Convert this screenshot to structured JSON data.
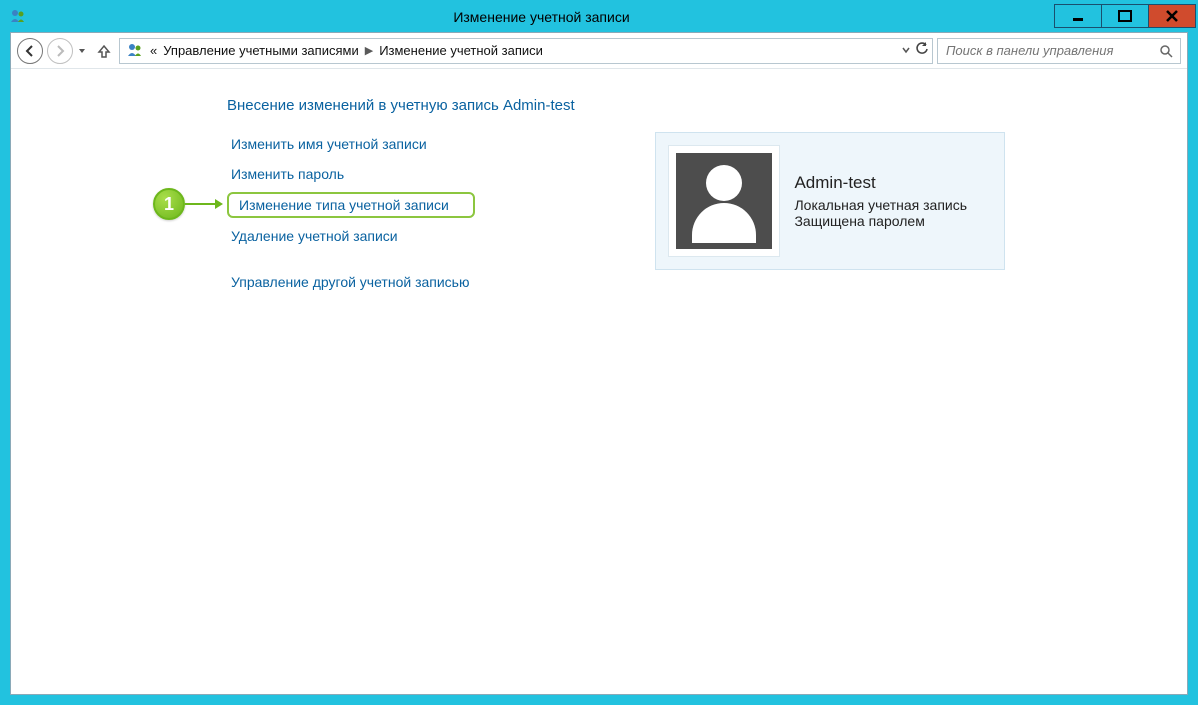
{
  "window": {
    "title": "Изменение учетной записи"
  },
  "breadcrumb": {
    "prefix": "«",
    "parent": "Управление учетными записями",
    "current": "Изменение учетной записи"
  },
  "search": {
    "placeholder": "Поиск в панели управления"
  },
  "page": {
    "heading": "Внесение изменений в учетную запись Admin-test",
    "links": [
      {
        "label": "Изменить имя учетной записи",
        "highlighted": false
      },
      {
        "label": "Изменить пароль",
        "highlighted": false
      },
      {
        "label": "Изменение типа учетной записи",
        "highlighted": true
      },
      {
        "label": "Удаление учетной записи",
        "highlighted": false
      }
    ],
    "link_manage_other": "Управление другой учетной записью"
  },
  "annotation": {
    "badge": "1"
  },
  "account": {
    "name": "Admin-test",
    "type": "Локальная учетная запись",
    "protected": "Защищена паролем"
  }
}
